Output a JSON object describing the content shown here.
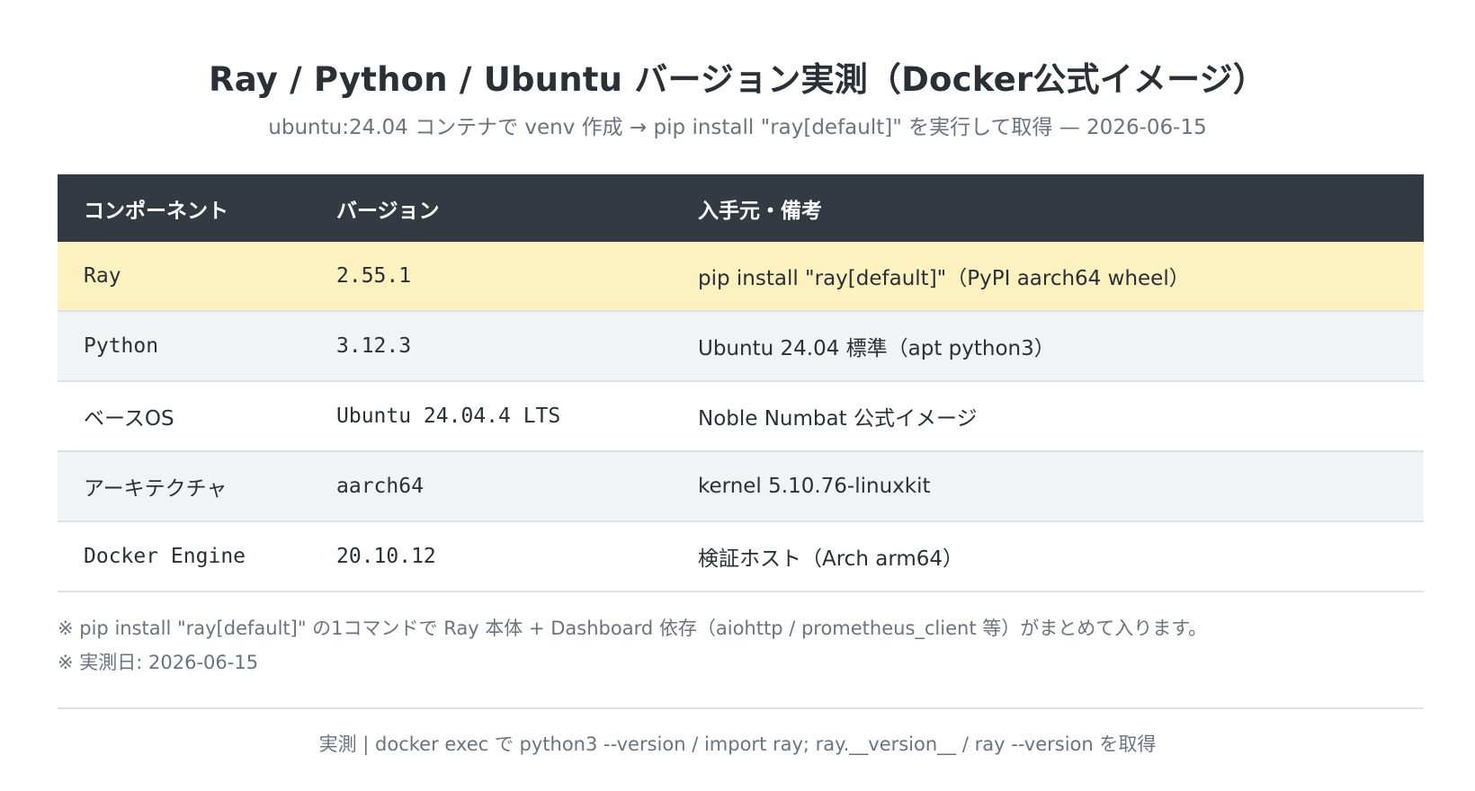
{
  "header": {
    "title": "Ray / Python / Ubuntu バージョン実測（Docker公式イメージ）",
    "subtitle": "ubuntu:24.04 コンテナで venv 作成 → pip install \"ray[default]\" を実行して取得 — 2026-06-15"
  },
  "table": {
    "columns": [
      "コンポーネント",
      "バージョン",
      "入手元・備考"
    ],
    "rows": [
      {
        "component": "Ray",
        "version": "2.55.1",
        "source": "pip install \"ray[default]\"（PyPI aarch64 wheel）",
        "highlight": true
      },
      {
        "component": "Python",
        "version": "3.12.3",
        "source": "Ubuntu 24.04 標準（apt python3）"
      },
      {
        "component": "ベースOS",
        "version": "Ubuntu 24.04.4 LTS",
        "source": "Noble Numbat 公式イメージ"
      },
      {
        "component": "アーキテクチャ",
        "version": "aarch64",
        "source": "kernel 5.10.76-linuxkit"
      },
      {
        "component": "Docker Engine",
        "version": "20.10.12",
        "source": "検証ホスト（Arch arm64）"
      }
    ]
  },
  "notes": [
    "※ pip install \"ray[default]\" の1コマンドで Ray 本体 + Dashboard 依存（aiohttp / prometheus_client 等）がまとめて入ります。",
    "※ 実測日: 2026-06-15"
  ],
  "footer": {
    "text": "実測 | docker exec で python3 --version / import ray; ray.__version__ / ray --version を取得"
  },
  "colors": {
    "header_bg": "#343a42",
    "highlight_row": "#fdf1c0",
    "alt_row": "#f2f3f5",
    "muted_text": "#6b7280"
  }
}
